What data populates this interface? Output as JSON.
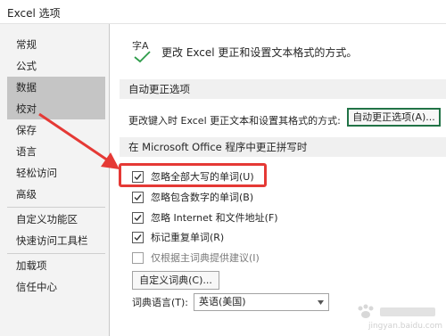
{
  "window": {
    "title": "Excel 选项"
  },
  "sidebar": {
    "items": [
      {
        "label": "常规",
        "selected": false
      },
      {
        "label": "公式",
        "selected": false
      },
      {
        "label": "数据",
        "selected": true
      },
      {
        "label": "校对",
        "selected": true
      },
      {
        "label": "保存",
        "selected": false
      },
      {
        "label": "语言",
        "selected": false
      },
      {
        "label": "轻松访问",
        "selected": false
      },
      {
        "label": "高级",
        "selected": false
      },
      {
        "label": "自定义功能区",
        "selected": false
      },
      {
        "label": "快速访问工具栏",
        "selected": false
      },
      {
        "label": "加载项",
        "selected": false
      },
      {
        "label": "信任中心",
        "selected": false
      }
    ]
  },
  "header": {
    "icon": "proofing-abc-check-icon",
    "icon_glyph": "字A",
    "description": "更改 Excel 更正和设置文本格式的方式。"
  },
  "autocorrect": {
    "section_title": "自动更正选项",
    "label": "更改键入时 Excel 更正文本和设置其格式的方式:",
    "button_label": "自动更正选项(A)..."
  },
  "spelling": {
    "section_title": "在 Microsoft Office 程序中更正拼写时",
    "options": [
      {
        "label": "忽略全部大写的单词(U)",
        "checked": true,
        "enabled": true
      },
      {
        "label": "忽略包含数字的单词(B)",
        "checked": true,
        "enabled": true
      },
      {
        "label": "忽略 Internet 和文件地址(F)",
        "checked": true,
        "enabled": true
      },
      {
        "label": "标记重复单词(R)",
        "checked": true,
        "enabled": true
      },
      {
        "label": "仅根据主词典提供建议(I)",
        "checked": false,
        "enabled": false
      }
    ],
    "custom_dict_button": "自定义词典(C)...",
    "dict_language_label": "词典语言(T):",
    "dict_language_value": "英语(美国)"
  },
  "annotations": {
    "highlight_color": "#e53935",
    "arrow_color": "#e53935"
  },
  "watermark": {
    "site": "jingyan.baidu.com"
  },
  "colors": {
    "selected_bg": "#c5c5c5",
    "button_accent": "#217346",
    "checkmark_green": "#2e9c4a"
  }
}
